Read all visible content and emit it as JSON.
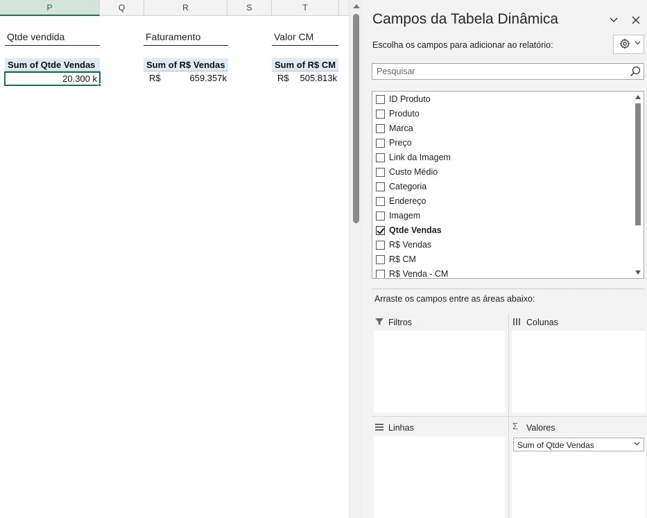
{
  "sheet": {
    "columns": [
      "P",
      "Q",
      "R",
      "S",
      "T"
    ],
    "active_column": "P",
    "titles": {
      "qtde": "Qtde vendida",
      "faturamento": "Faturamento",
      "valor_cm": "Valor CM"
    },
    "pivots": {
      "qtde": {
        "header": "Sum of Qtde Vendas",
        "value": "20.300 k"
      },
      "vendas": {
        "header": "Sum of R$ Vendas",
        "currency": "R$",
        "value": "659.357k"
      },
      "cm": {
        "header": "Sum of R$ CM",
        "currency": "R$",
        "value": "505.813k"
      }
    }
  },
  "pane": {
    "title": "Campos da Tabela Dinâmica",
    "subtitle": "Escolha os campos para adicionar ao relatório:",
    "search_placeholder": "Pesquisar",
    "fields": [
      {
        "label": "ID Produto",
        "checked": false
      },
      {
        "label": "Produto",
        "checked": false
      },
      {
        "label": "Marca",
        "checked": false
      },
      {
        "label": "Preço",
        "checked": false
      },
      {
        "label": "Link da Imagem",
        "checked": false
      },
      {
        "label": "Custo Médio",
        "checked": false
      },
      {
        "label": "Categoria",
        "checked": false
      },
      {
        "label": "Endereço",
        "checked": false
      },
      {
        "label": "Imagem",
        "checked": false
      },
      {
        "label": "Qtde Vendas",
        "checked": true
      },
      {
        "label": "R$ Vendas",
        "checked": false
      },
      {
        "label": "R$ CM",
        "checked": false
      },
      {
        "label": "R$ Venda - CM",
        "checked": false
      }
    ],
    "drag_hint": "Arraste os campos entre as áreas abaixo:",
    "areas": {
      "filtros": "Filtros",
      "colunas": "Colunas",
      "linhas": "Linhas",
      "valores": "Valores"
    },
    "values_items": [
      "Sum of Qtde Vendas"
    ]
  },
  "colors": {
    "pivot_header_bg": "#ddebf7",
    "excel_green": "#1e7145",
    "pane_bg": "#f3f3f3"
  }
}
